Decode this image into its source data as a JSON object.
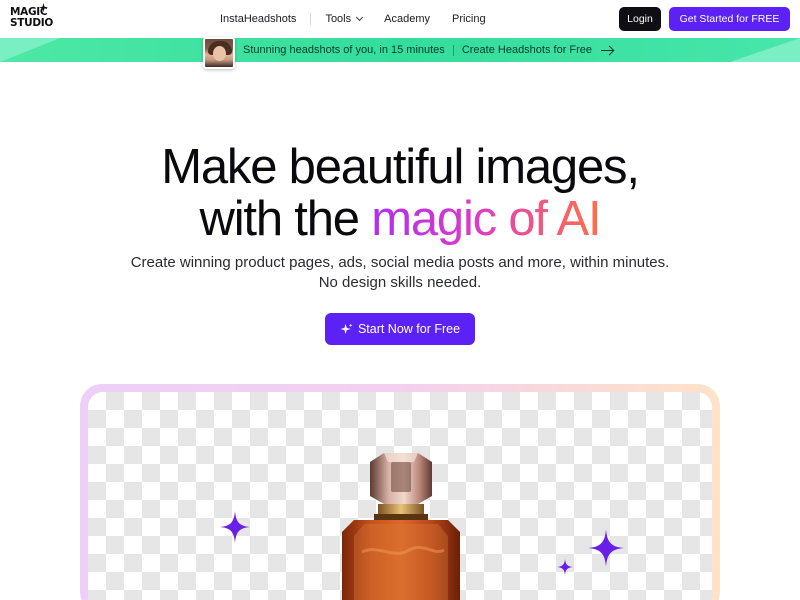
{
  "nav": {
    "logo_top": "MAGIC",
    "logo_bottom": "STUDIO",
    "links": [
      "InstaHeadshots",
      "Tools",
      "Academy",
      "Pricing"
    ],
    "login": "Login",
    "cta": "Get Started for FREE"
  },
  "banner": {
    "text": "Stunning headshots of you, in 15 minutes",
    "link": "Create Headshots for Free"
  },
  "hero": {
    "title_line1": "Make beautiful images,",
    "title_line2_plain": "with the ",
    "title_line2_gradient": "magic of AI",
    "subtitle_line1": "Create winning product pages, ads, social media posts and more, within minutes.",
    "subtitle_line2": "No design skills needed.",
    "start_button": "Start Now for Free"
  },
  "colors": {
    "accent": "#5b21f5",
    "banner": "#33dd9c",
    "sparkle": "#6a1fe8"
  },
  "icons": [
    "sparkle-icon",
    "chevron-down-icon",
    "arrow-right-icon"
  ]
}
